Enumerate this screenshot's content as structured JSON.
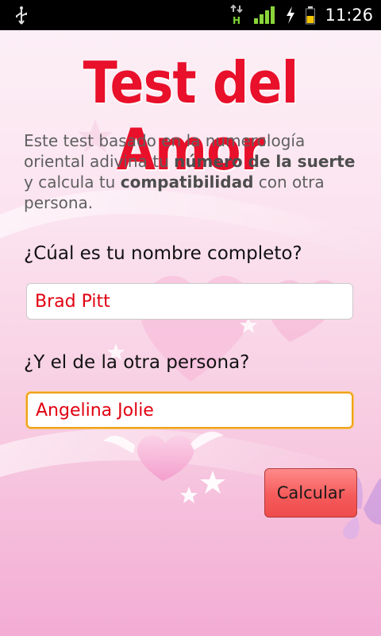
{
  "status_bar": {
    "time": "11:26",
    "network_type": "H",
    "icons": [
      "usb-icon",
      "data-arrows-icon",
      "signal-icon",
      "charging-icon",
      "battery-icon"
    ]
  },
  "header": {
    "title": "Test del Amor"
  },
  "intro": {
    "part1": "Este test basado en la numerología oriental adivina tu ",
    "bold1": "número de la suerte",
    "part2": " y calcula tu ",
    "bold2": "compatibilidad",
    "part3": " con otra persona."
  },
  "form": {
    "question1": "¿Cúal es tu nombre completo?",
    "name1_value": "Brad Pitt",
    "question2": "¿Y el de la otra persona?",
    "name2_value": "Angelina Jolie",
    "submit_label": "Calcular"
  },
  "colors": {
    "title": "#e8102a",
    "input_text": "#e10010",
    "button": "#f55b5b",
    "focus_border": "#f0a21a"
  }
}
